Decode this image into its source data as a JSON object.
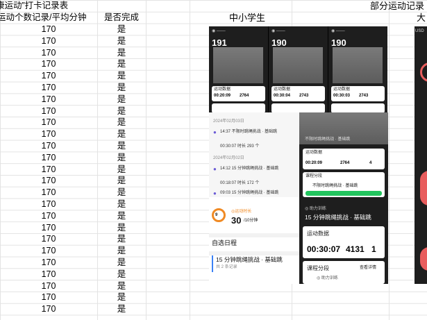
{
  "sheet": {
    "title": "康运动”打卡记录表",
    "col_count_header": "运动个数记录/平均分钟",
    "col_done_header": "是否完成",
    "section_primary": "中小学生",
    "section_records": "部分运动记录",
    "section_college": "大",
    "rows": [
      {
        "count": "170",
        "done": "是"
      },
      {
        "count": "170",
        "done": "是"
      },
      {
        "count": "170",
        "done": "是"
      },
      {
        "count": "170",
        "done": "是"
      },
      {
        "count": "170",
        "done": "是"
      },
      {
        "count": "170",
        "done": "是"
      },
      {
        "count": "170",
        "done": "是"
      },
      {
        "count": "170",
        "done": "是"
      },
      {
        "count": "170",
        "done": "是"
      },
      {
        "count": "170",
        "done": "是"
      },
      {
        "count": "170",
        "done": "是"
      },
      {
        "count": "170",
        "done": "是"
      },
      {
        "count": "170",
        "done": "是"
      },
      {
        "count": "170",
        "done": "是"
      },
      {
        "count": "170",
        "done": "是"
      },
      {
        "count": "170",
        "done": "是"
      },
      {
        "count": "170",
        "done": "是"
      },
      {
        "count": "170",
        "done": "是"
      },
      {
        "count": "170",
        "done": "是"
      },
      {
        "count": "170",
        "done": "是"
      },
      {
        "count": "170",
        "done": "是"
      },
      {
        "count": "170",
        "done": "是"
      },
      {
        "count": "170",
        "done": "是"
      },
      {
        "count": "170",
        "done": "是"
      },
      {
        "count": "170",
        "done": "是"
      }
    ]
  },
  "screens": {
    "top_a": {
      "count": "191",
      "label": "运动数据",
      "time": "00:20:09",
      "num": "2764"
    },
    "top_b": {
      "count": "190",
      "label": "运动数据",
      "time": "00:30:04",
      "num": "2743"
    },
    "top_c": {
      "count": "190",
      "label": "运动数据",
      "time": "00:30:03",
      "num": "2743"
    },
    "log": {
      "date1": "2024年02月03日",
      "item1": "14:37 不限时跳绳挑战 · 基础跳",
      "item1_stats": "00:30:07 时长   293 个",
      "date2": "2024年02月02日",
      "item2": "14:12 15 分钟跳绳挑战 · 基础跳",
      "item2_stats": "00:18:07 时长   172 个",
      "item3": "09:03 15 分钟跳绳挑战 · 基础跳"
    },
    "summary": {
      "badge": "9",
      "label": "◎运动时长",
      "value": "30",
      "unit": "/10分钟",
      "schedule": "自选日程",
      "course": "15 分钟跳绳挑战 · 基础跳",
      "course_sub": "共 2 条记录"
    },
    "mid": {
      "course_title": "不限时跳绳挑战 · 基础跳",
      "data_label": "运动数据",
      "time": "00:20:09",
      "num": "2764",
      "k": "4",
      "seg_label": "课程分段",
      "seg_item": "不限时跳绳挑战 · 基础跳"
    },
    "bottom": {
      "head_small": "◎ 助力训练",
      "course": "15 分钟跳绳挑战 · 基础跳",
      "data_label": "运动数据",
      "time": "00:30:07",
      "num": "4131",
      "k": "1",
      "seg_label": "课程分段",
      "seg_btn": "查看详情",
      "seg_item": "◎ 助力训练"
    },
    "right_edge": {
      "label": "USD"
    }
  }
}
